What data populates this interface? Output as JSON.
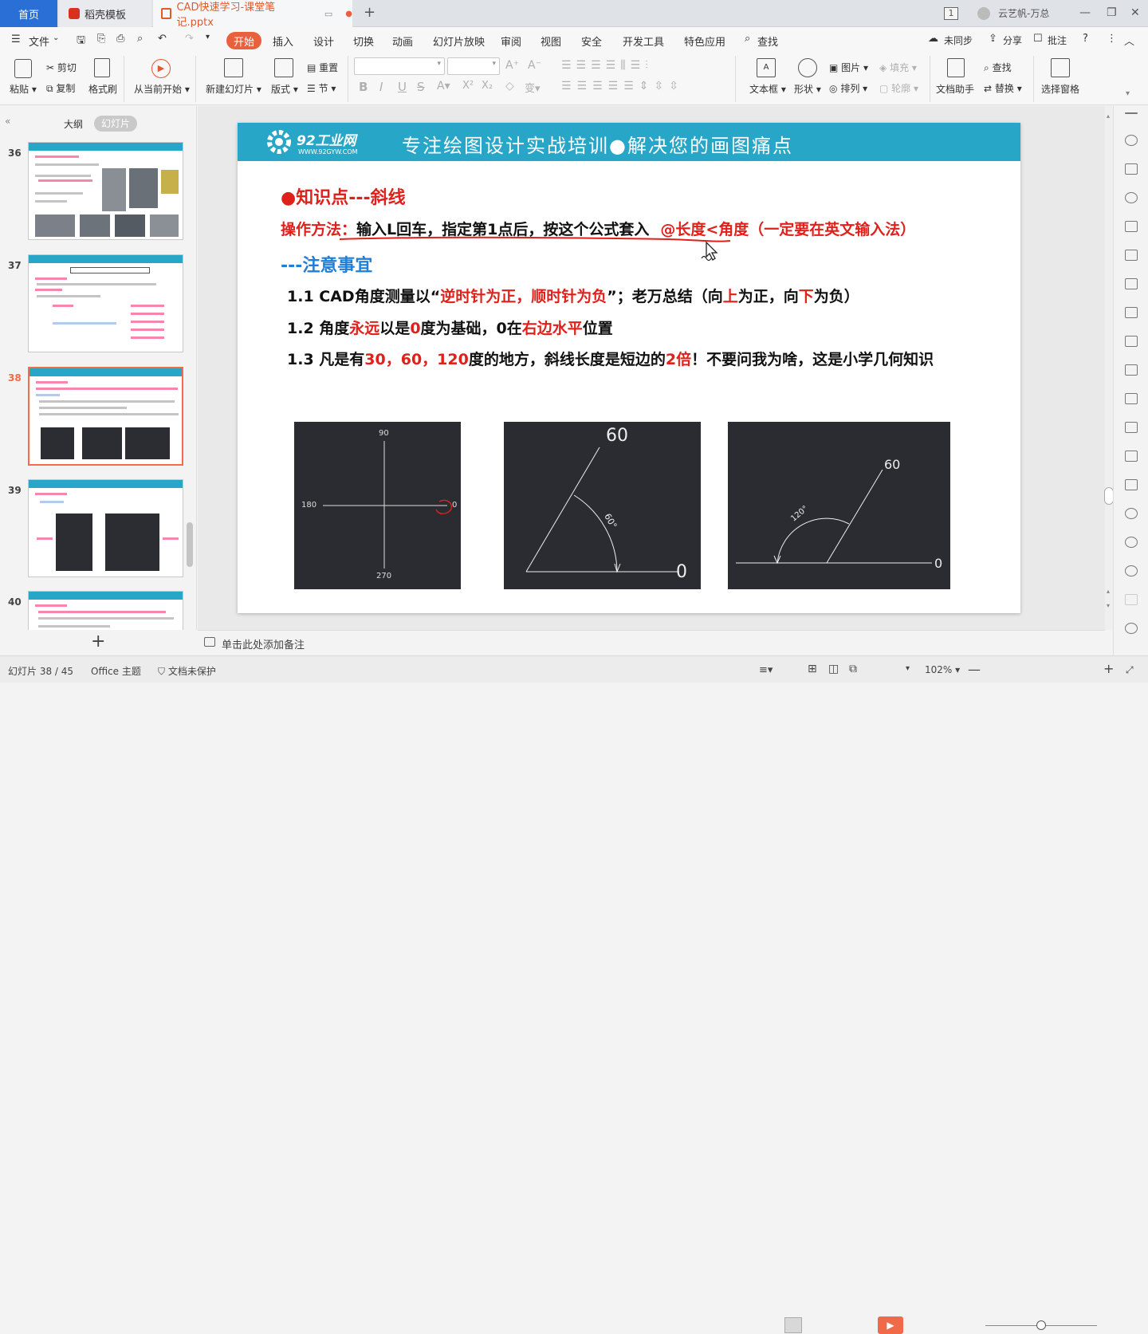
{
  "titlebar": {
    "tab_home": "首页",
    "tab_template": "稻壳模板",
    "tab_doc": "CAD快速学习-课堂笔记.pptx",
    "new_tab": "+",
    "badge": "1",
    "user": "云艺帆-万总"
  },
  "menubar": {
    "file": "文件",
    "items": [
      "开始",
      "插入",
      "设计",
      "切换",
      "动画",
      "幻灯片放映",
      "审阅",
      "视图",
      "安全",
      "开发工具",
      "特色应用"
    ],
    "search": "查找",
    "sync": "未同步",
    "share": "分享",
    "comment": "批注"
  },
  "ribbon": {
    "paste": "粘贴",
    "cut": "剪切",
    "copy": "复制",
    "format_painter": "格式刷",
    "from_current": "从当前开始",
    "new_slide": "新建幻灯片",
    "layout": "版式",
    "reset": "重置",
    "section": "节",
    "textbox": "文本框",
    "shape": "形状",
    "picture": "图片",
    "fill": "填充",
    "arrange": "排列",
    "outline": "轮廓",
    "doc_assistant": "文档助手",
    "find": "查找",
    "replace": "替换",
    "select_pane": "选择窗格"
  },
  "sidebar": {
    "tab_outline": "大纲",
    "tab_slides": "幻灯片",
    "slide_numbers": [
      "36",
      "37",
      "38",
      "39",
      "40"
    ],
    "add": "+"
  },
  "slide": {
    "logo_name": "92工业网",
    "logo_url": "WWW.92GYW.COM",
    "banner_title": "专注绘图设计实战培训●解决您的画图痛点",
    "heading": "●知识点---斜线",
    "method_label": "操作方法：",
    "method_text": "输入L回车，指定第1点后，按这个公式套入",
    "method_formula": "@长度<角度（一定要在英文输入法）",
    "notice": "---注意事宜",
    "p1_a": "1.1 CAD角度测量以“",
    "p1_b": "逆时针为正，顺时针为负",
    "p1_c": "”；老万总结（向",
    "p1_d": "上",
    "p1_e": "为正，向",
    "p1_f": "下",
    "p1_g": "为负）",
    "p2_a": "1.2 角度",
    "p2_b": "永远",
    "p2_c": "以是",
    "p2_d": "0",
    "p2_e": "度为基础，0在",
    "p2_f": "右边水平",
    "p2_g": "位置",
    "p3_a": "1.3 凡是有",
    "p3_b": "30，60，120",
    "p3_c": "度的地方，斜线长度是短边的",
    "p3_d": "2倍",
    "p3_e": "！不要问我为啥，这是小学几何知识",
    "img1": {
      "top": "90",
      "left": "180",
      "right": "0",
      "bottom": "270"
    },
    "img2": {
      "top": "60",
      "angle": "60°",
      "right": "0"
    },
    "img3": {
      "top": "60",
      "angle": "120°",
      "right": "0"
    }
  },
  "notes": {
    "placeholder": "单击此处添加备注"
  },
  "status": {
    "slide_info": "幻灯片 38 / 45",
    "theme": "Office 主题",
    "protect": "文档未保护",
    "zoom": "102%"
  },
  "colors": {
    "accent": "#e8603c",
    "banner": "#27a6c8",
    "red": "#e0201a",
    "blue": "#1f7fd8",
    "cad_bg": "#2a2c31"
  }
}
